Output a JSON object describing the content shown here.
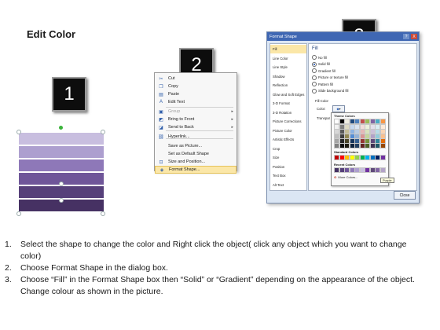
{
  "slide": {
    "title": "Edit Color"
  },
  "steps": {
    "one": "1",
    "two": "2",
    "three": "3"
  },
  "shape_colors": [
    "#c8bedf",
    "#ad9fcf",
    "#8e78b8",
    "#6f5699",
    "#56407a",
    "#463163"
  ],
  "context_menu": {
    "items": [
      {
        "label": "Cut",
        "icon": "scissors-icon",
        "glyph": "✂",
        "disabled": false,
        "arrow": false
      },
      {
        "label": "Copy",
        "icon": "copy-icon",
        "glyph": "❐",
        "disabled": false,
        "arrow": false
      },
      {
        "label": "Paste",
        "icon": "paste-icon",
        "glyph": "▤",
        "disabled": false,
        "arrow": false
      },
      {
        "label": "Edit Text",
        "icon": "edit-text-icon",
        "glyph": "A",
        "disabled": false,
        "arrow": false
      },
      {
        "label": "Group",
        "icon": "group-icon",
        "glyph": "▣",
        "disabled": true,
        "arrow": true
      },
      {
        "label": "Bring to Front",
        "icon": "bring-front-icon",
        "glyph": "◩",
        "disabled": false,
        "arrow": true
      },
      {
        "label": "Send to Back",
        "icon": "send-back-icon",
        "glyph": "◪",
        "disabled": false,
        "arrow": true
      },
      {
        "label": "Hyperlink...",
        "icon": "hyperlink-icon",
        "glyph": "⛓",
        "disabled": false,
        "arrow": false
      },
      {
        "label": "Save as Picture...",
        "icon": "",
        "glyph": "",
        "disabled": false,
        "arrow": false
      },
      {
        "label": "Set as Default Shape",
        "icon": "",
        "glyph": "",
        "disabled": false,
        "arrow": false
      },
      {
        "label": "Size and Position...",
        "icon": "size-position-icon",
        "glyph": "⊡",
        "disabled": false,
        "arrow": false
      },
      {
        "label": "Format Shape...",
        "icon": "format-shape-icon",
        "glyph": "◈",
        "disabled": false,
        "arrow": false,
        "highlighted": true
      }
    ]
  },
  "dialog": {
    "title": "Format Shape",
    "help": "?",
    "close": "X",
    "categories": [
      "Fill",
      "Line Color",
      "Line Style",
      "Shadow",
      "Reflection",
      "Glow and Soft Edges",
      "3-D Format",
      "3-D Rotation",
      "Picture Corrections",
      "Picture Color",
      "Artistic Effects",
      "Crop",
      "Size",
      "Position",
      "Text Box",
      "Alt Text"
    ],
    "selected_category": "Fill",
    "pane": {
      "heading": "Fill",
      "options": [
        {
          "label": "No fill",
          "checked": false
        },
        {
          "label": "Solid fill",
          "checked": true
        },
        {
          "label": "Gradient fill",
          "checked": false
        },
        {
          "label": "Picture or texture fill",
          "checked": false
        },
        {
          "label": "Pattern fill",
          "checked": false
        },
        {
          "label": "Slide background fill",
          "checked": false
        }
      ],
      "fill_color_label": "Fill Color",
      "color_label": "Color:",
      "transparency_label": "Transpar"
    },
    "palette": {
      "theme_label": "Theme Colors",
      "standard_label": "Standard Colors",
      "recent_label": "Recent Colors",
      "more_label": "More Colors...",
      "tooltip": "Purple",
      "theme_top": [
        "#ffffff",
        "#000000",
        "#eeece1",
        "#1f497d",
        "#4f81bd",
        "#c0504d",
        "#9bbb59",
        "#8064a2",
        "#4bacc6",
        "#f79646"
      ],
      "theme_shades": [
        [
          "#f2f2f2",
          "#7f7f7f",
          "#ddd9c3",
          "#c6d9f0",
          "#dbe5f1",
          "#f2dcdb",
          "#ebf1dd",
          "#e5e0ec",
          "#dbeef3",
          "#fdeada"
        ],
        [
          "#d8d8d8",
          "#595959",
          "#c4bd97",
          "#8db3e2",
          "#b8cce4",
          "#e5b9b7",
          "#d7e3bc",
          "#ccc1d9",
          "#b7dde8",
          "#fbd5b5"
        ],
        [
          "#bfbfbf",
          "#3f3f3f",
          "#938953",
          "#548dd4",
          "#95b3d7",
          "#d99694",
          "#c3d69b",
          "#b2a2c7",
          "#92cddc",
          "#fac08f"
        ],
        [
          "#a5a5a5",
          "#262626",
          "#494429",
          "#17365d",
          "#366092",
          "#953734",
          "#76923c",
          "#5f497a",
          "#31859b",
          "#e36c09"
        ],
        [
          "#7f7f7f",
          "#0c0c0c",
          "#1d1b10",
          "#0f243e",
          "#244061",
          "#632423",
          "#4f6128",
          "#3f3151",
          "#205867",
          "#974806"
        ]
      ],
      "standard": [
        "#c00000",
        "#ff0000",
        "#ffc000",
        "#ffff00",
        "#92d050",
        "#00b050",
        "#00b0f0",
        "#0070c0",
        "#002060",
        "#7030a0"
      ],
      "recent": [
        "#463163",
        "#56407a",
        "#6f5699",
        "#8e78b8",
        "#ad9fcf",
        "#c8bedf",
        "#7030a0",
        "#5f497a",
        "#8064a2",
        "#b2a2c7"
      ]
    },
    "close_button": "Close"
  },
  "instructions": [
    {
      "num": "1.",
      "text": "Select the shape to change the color and Right click the object( click any object which you want to change color)"
    },
    {
      "num": "2.",
      "text": "Choose Format Shape in the dialog box."
    },
    {
      "num": "3.",
      "text": "Choose “Fill” in the Format Shape box then “Solid” or “Gradient” depending on the appearance of the object. Change colour as shown in the picture."
    }
  ]
}
